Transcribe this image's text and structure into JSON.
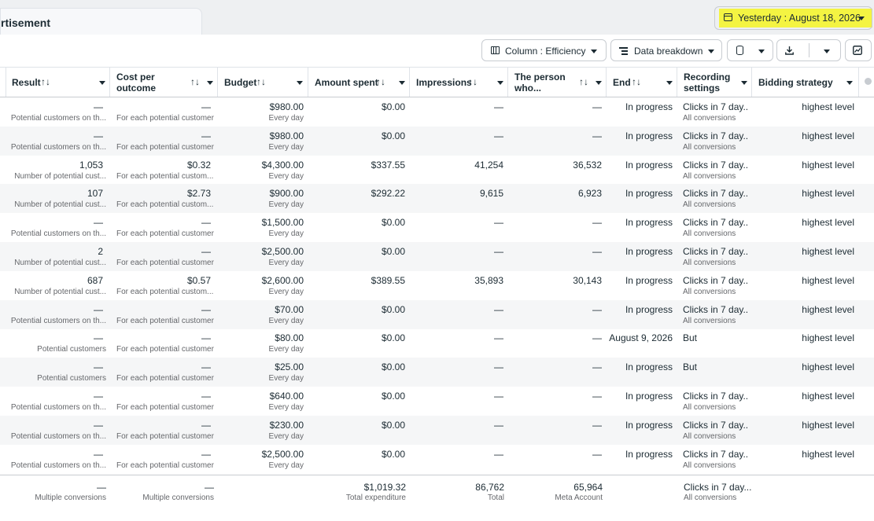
{
  "tab": {
    "label": "rtisement"
  },
  "date_range": {
    "label": "Yesterday : August 18, 2026"
  },
  "toolbar": {
    "columns_label": "Column : Efficiency",
    "breakdown_label": "Data breakdown"
  },
  "columns": [
    {
      "label": "Result"
    },
    {
      "label": "Cost per outcome"
    },
    {
      "label": "Budget"
    },
    {
      "label": "Amount spent"
    },
    {
      "label": "Impressions"
    },
    {
      "label": "The person who..."
    },
    {
      "label": "End"
    },
    {
      "label": "Recording settings"
    },
    {
      "label": "Bidding strategy"
    }
  ],
  "rows": [
    {
      "result": "—",
      "result_sub": "Potential customers on th...",
      "cost": "—",
      "cost_sub": "For each potential customer",
      "budget": "$980.00",
      "budget_sub": "Every day",
      "spent": "$0.00",
      "impressions": "—",
      "reach": "—",
      "end": "In progress",
      "recording": "Clicks in 7 day...",
      "recording_sub": "All conversions",
      "bidding": "highest level"
    },
    {
      "result": "—",
      "result_sub": "Potential customers on th...",
      "cost": "—",
      "cost_sub": "For each potential customer",
      "budget": "$980.00",
      "budget_sub": "Every day",
      "spent": "$0.00",
      "impressions": "—",
      "reach": "—",
      "end": "In progress",
      "recording": "Clicks in 7 day...",
      "recording_sub": "All conversions",
      "bidding": "highest level"
    },
    {
      "result": "1,053",
      "result_sub": "Number of potential cust...",
      "cost": "$0.32",
      "cost_sub": "For each potential custom...",
      "budget": "$4,300.00",
      "budget_sub": "Every day",
      "spent": "$337.55",
      "impressions": "41,254",
      "reach": "36,532",
      "end": "In progress",
      "recording": "Clicks in 7 day...",
      "recording_sub": "All conversions",
      "bidding": "highest level"
    },
    {
      "result": "107",
      "result_sub": "Number of potential cust...",
      "cost": "$2.73",
      "cost_sub": "For each potential custom...",
      "budget": "$900.00",
      "budget_sub": "Every day",
      "spent": "$292.22",
      "impressions": "9,615",
      "reach": "6,923",
      "end": "In progress",
      "recording": "Clicks in 7 day...",
      "recording_sub": "All conversions",
      "bidding": "highest level"
    },
    {
      "result": "—",
      "result_sub": "Potential customers on th...",
      "cost": "—",
      "cost_sub": "For each potential customer",
      "budget": "$1,500.00",
      "budget_sub": "Every day",
      "spent": "$0.00",
      "impressions": "—",
      "reach": "—",
      "end": "In progress",
      "recording": "Clicks in 7 day...",
      "recording_sub": "All conversions",
      "bidding": "highest level"
    },
    {
      "result": "2",
      "result_sub": "Number of potential cust...",
      "cost": "—",
      "cost_sub": "For each potential customer",
      "budget": "$2,500.00",
      "budget_sub": "Every day",
      "spent": "$0.00",
      "impressions": "—",
      "reach": "—",
      "end": "In progress",
      "recording": "Clicks in 7 day...",
      "recording_sub": "All conversions",
      "bidding": "highest level"
    },
    {
      "result": "687",
      "result_sub": "Number of potential cust...",
      "cost": "$0.57",
      "cost_sub": "For each potential custom...",
      "budget": "$2,600.00",
      "budget_sub": "Every day",
      "spent": "$389.55",
      "impressions": "35,893",
      "reach": "30,143",
      "end": "In progress",
      "recording": "Clicks in 7 day...",
      "recording_sub": "All conversions",
      "bidding": "highest level"
    },
    {
      "result": "—",
      "result_sub": "Potential customers on th...",
      "cost": "—",
      "cost_sub": "For each potential customer",
      "budget": "$70.00",
      "budget_sub": "Every day",
      "spent": "$0.00",
      "impressions": "—",
      "reach": "—",
      "end": "In progress",
      "recording": "Clicks in 7 day...",
      "recording_sub": "All conversions",
      "bidding": "highest level"
    },
    {
      "result": "—",
      "result_sub": "Potential customers",
      "cost": "—",
      "cost_sub": "For each potential customer",
      "budget": "$80.00",
      "budget_sub": "Every day",
      "spent": "$0.00",
      "impressions": "—",
      "reach": "—",
      "end": "August 9, 2026",
      "recording": "But",
      "recording_sub": "",
      "bidding": "highest level"
    },
    {
      "result": "—",
      "result_sub": "Potential customers",
      "cost": "—",
      "cost_sub": "For each potential customer",
      "budget": "$25.00",
      "budget_sub": "Every day",
      "spent": "$0.00",
      "impressions": "—",
      "reach": "—",
      "end": "In progress",
      "recording": "But",
      "recording_sub": "",
      "bidding": "highest level"
    },
    {
      "result": "—",
      "result_sub": "Potential customers on th...",
      "cost": "—",
      "cost_sub": "For each potential customer",
      "budget": "$640.00",
      "budget_sub": "Every day",
      "spent": "$0.00",
      "impressions": "—",
      "reach": "—",
      "end": "In progress",
      "recording": "Clicks in 7 day...",
      "recording_sub": "All conversions",
      "bidding": "highest level"
    },
    {
      "result": "—",
      "result_sub": "Potential customers on th...",
      "cost": "—",
      "cost_sub": "For each potential customer",
      "budget": "$230.00",
      "budget_sub": "Every day",
      "spent": "$0.00",
      "impressions": "—",
      "reach": "—",
      "end": "In progress",
      "recording": "Clicks in 7 day...",
      "recording_sub": "All conversions",
      "bidding": "highest level"
    },
    {
      "result": "—",
      "result_sub": "Potential customers on th...",
      "cost": "—",
      "cost_sub": "For each potential customer",
      "budget": "$2,500.00",
      "budget_sub": "Every day",
      "spent": "$0.00",
      "impressions": "—",
      "reach": "—",
      "end": "In progress",
      "recording": "Clicks in 7 day...",
      "recording_sub": "All conversions",
      "bidding": "highest level"
    }
  ],
  "footer": {
    "result": "—",
    "result_sub": "Multiple conversions",
    "cost": "—",
    "cost_sub": "Multiple conversions",
    "spent": "$1,019.32",
    "spent_sub": "Total expenditure",
    "impressions": "86,762",
    "impressions_sub": "Total",
    "reach": "65,964",
    "reach_sub": "Meta Account",
    "recording": "Clicks in 7 day...",
    "recording_sub": "All conversions"
  }
}
